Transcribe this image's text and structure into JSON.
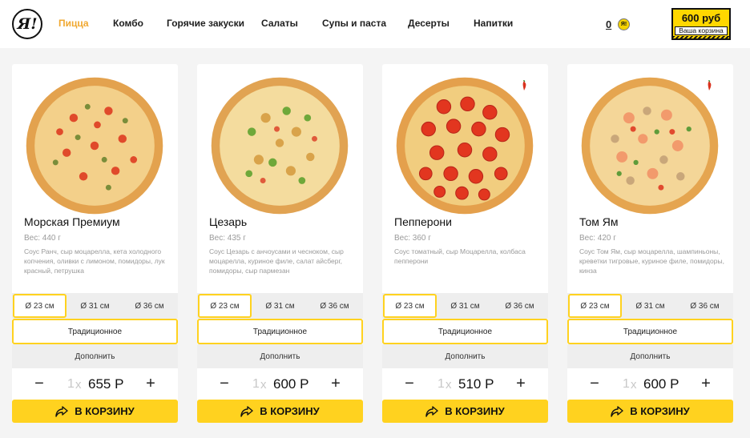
{
  "brand": {
    "logo_text": "Я!"
  },
  "nav": [
    {
      "label": "Пицца",
      "active": true
    },
    {
      "label": "Комбо"
    },
    {
      "label": "Горячие закуски"
    },
    {
      "label": "Салаты"
    },
    {
      "label": "Супы и паста"
    },
    {
      "label": "Десерты"
    },
    {
      "label": "Напитки"
    }
  ],
  "header": {
    "bonus_count": "0",
    "coin_label": "Я!",
    "cart_price": "600 руб",
    "cart_label": "Ваша корзина"
  },
  "colors": {
    "accent": "#ffd21f",
    "active_nav": "#f0a830"
  },
  "products": [
    {
      "title": "Морская Премиум",
      "weight": "Вес: 440 г",
      "description": "Соус Ранч, сыр моцарелла, кета холодного копчения, оливки с лимоном, помидоры, лук красный, петрушка",
      "spicy": false,
      "sizes": [
        "Ø 23 см",
        "Ø 31 см",
        "Ø 36 см"
      ],
      "dough": "Традиционное",
      "extra": "Дополнить",
      "quantity": "1",
      "times": "x",
      "price": "655 Р",
      "buy": "В КОРЗИНУ"
    },
    {
      "title": "Цезарь",
      "weight": "Вес: 435 г",
      "description": "Соус Цезарь с анчоусами и чесноком, сыр моцарелла, куриное филе, салат айсберг, помидоры, сыр пармезан",
      "spicy": false,
      "sizes": [
        "Ø 23 см",
        "Ø 31 см",
        "Ø 36 см"
      ],
      "dough": "Традиционное",
      "extra": "Дополнить",
      "quantity": "1",
      "times": "x",
      "price": "600 Р",
      "buy": "В КОРЗИНУ"
    },
    {
      "title": "Пепперони",
      "weight": "Вес: 360 г",
      "description": "Соус томатный, сыр Моцарелла, колбаса пепперони",
      "spicy": true,
      "sizes": [
        "Ø 23 см",
        "Ø 31 см",
        "Ø 36 см"
      ],
      "dough": "Традиционное",
      "extra": "Дополнить",
      "quantity": "1",
      "times": "x",
      "price": "510 Р",
      "buy": "В КОРЗИНУ"
    },
    {
      "title": "Том Ям",
      "weight": "Вес: 420 г",
      "description": "Соус Том Ям, сыр моцарелла, шампиньоны, креветки тигровые, куриное филе, помидоры, кинза",
      "spicy": true,
      "sizes": [
        "Ø 23 см",
        "Ø 31 см",
        "Ø 36 см"
      ],
      "dough": "Традиционное",
      "extra": "Дополнить",
      "quantity": "1",
      "times": "x",
      "price": "600 Р",
      "buy": "В КОРЗИНУ"
    }
  ]
}
